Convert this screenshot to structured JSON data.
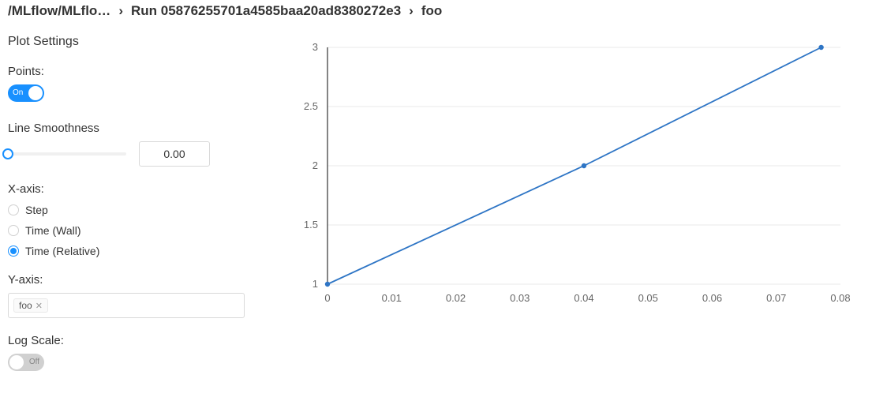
{
  "breadcrumb": {
    "part1": "/MLflow/MLflo…",
    "part2": "Run 05876255701a4585baa20ad8380272e3",
    "part3": "foo"
  },
  "settings": {
    "title": "Plot Settings",
    "points": {
      "label": "Points:",
      "state_label": "On",
      "on": true
    },
    "smoothness": {
      "label": "Line Smoothness",
      "value": "0.00"
    },
    "xaxis": {
      "label": "X-axis:",
      "options": [
        "Step",
        "Time (Wall)",
        "Time (Relative)"
      ],
      "selected_index": 2
    },
    "yaxis": {
      "label": "Y-axis:",
      "tags": [
        "foo"
      ]
    },
    "logscale": {
      "label": "Log Scale:",
      "state_label": "Off",
      "on": false
    }
  },
  "chart_data": {
    "type": "line",
    "x": [
      0,
      0.04,
      0.077
    ],
    "y": [
      1,
      2,
      3
    ],
    "xlim": [
      0,
      0.08
    ],
    "ylim": [
      1,
      3
    ],
    "xticks": [
      0,
      0.01,
      0.02,
      0.03,
      0.04,
      0.05,
      0.06,
      0.07,
      0.08
    ],
    "yticks": [
      1,
      1.5,
      2,
      2.5,
      3
    ],
    "xlabel": "",
    "ylabel": "",
    "title": "",
    "color": "#2e75c5"
  }
}
